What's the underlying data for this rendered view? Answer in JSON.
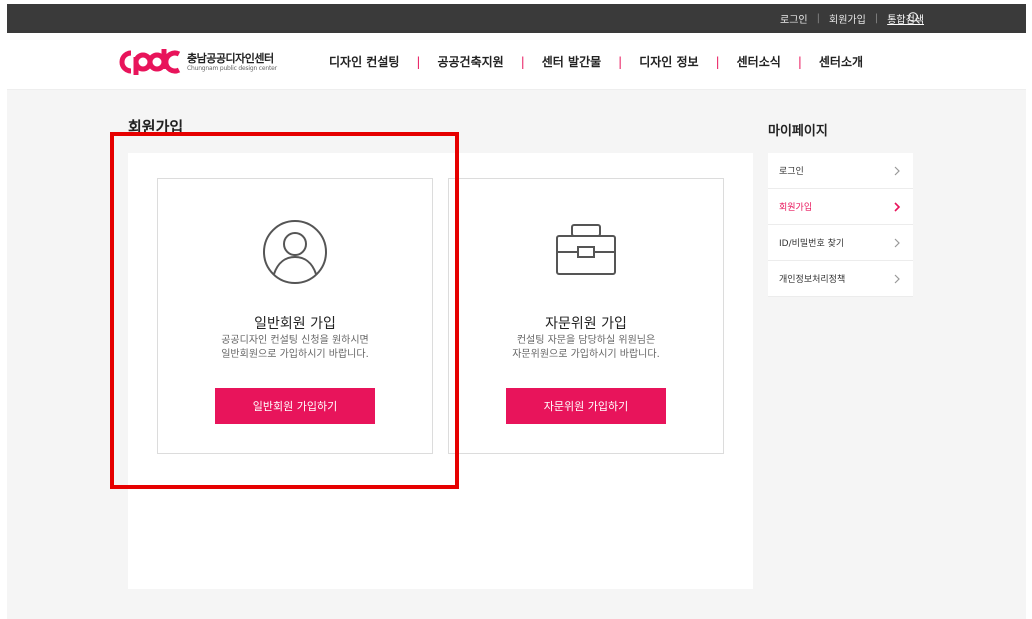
{
  "topbar": {
    "links": [
      "로그인",
      "회원가입",
      "통합검색"
    ]
  },
  "logo": {
    "name": "충남공공디자인센터",
    "subtitle": "Chungnam public design center"
  },
  "gnb": [
    "디자인 컨설팅",
    "공공건축지원",
    "센터 발간물",
    "디자인 정보",
    "센터소식",
    "센터소개"
  ],
  "page_title": "회원가입",
  "cards": {
    "general": {
      "title": "일반회원 가입",
      "desc1": "공공디자인 컨설팅 신청을 원하시면",
      "desc2": "일반회원으로 가입하시기 바랍니다.",
      "button": "일반회원 가입하기",
      "icon": "user-circle-icon"
    },
    "advisor": {
      "title": "자문위원 가입",
      "desc1": "컨설팅 자문을 담당하실 위원님은",
      "desc2": "자문위원으로 가입하시기 바랍니다.",
      "button": "자문위원 가입하기",
      "icon": "briefcase-icon"
    }
  },
  "side": {
    "title": "마이페이지",
    "items": [
      {
        "label": "로그인",
        "active": false
      },
      {
        "label": "회원가입",
        "active": true
      },
      {
        "label": "ID/비밀번호 찾기",
        "active": false
      },
      {
        "label": "개인정보처리정책",
        "active": false
      }
    ]
  },
  "colors": {
    "accent": "#e8145b",
    "topbar": "#3a3a3a",
    "highlight": "#e60000"
  }
}
